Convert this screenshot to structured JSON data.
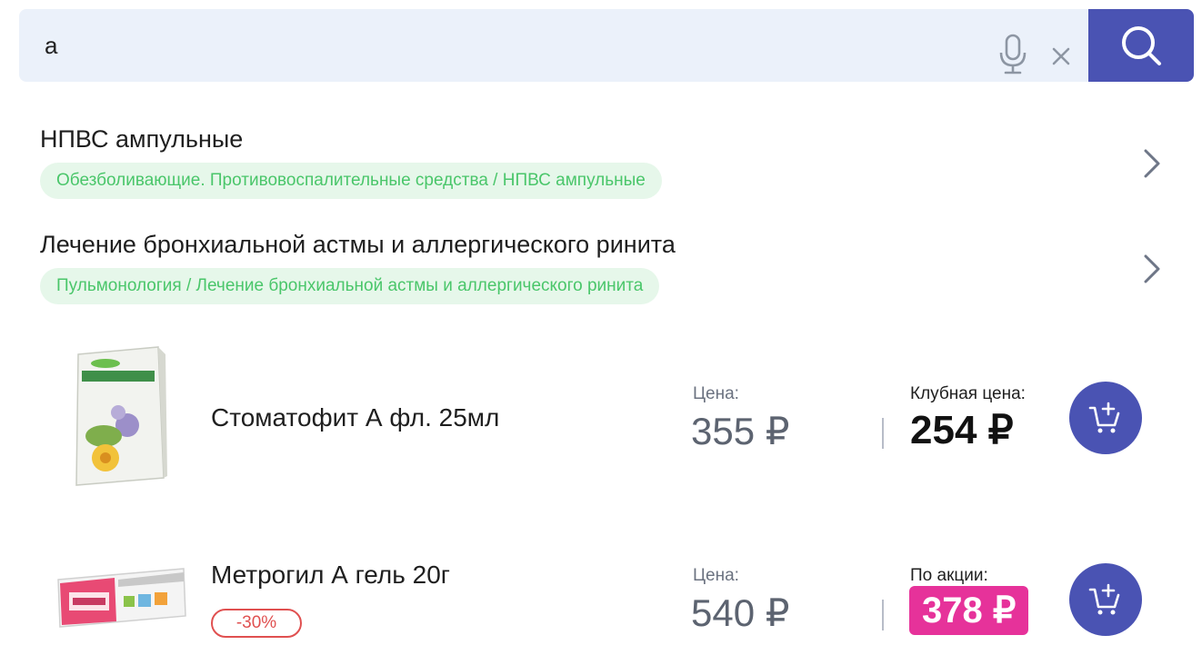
{
  "search": {
    "value": "а",
    "mic_icon": "microphone-icon",
    "clear_icon": "close-icon",
    "button_icon": "search-icon"
  },
  "categories": [
    {
      "title": "НПВС ампульные",
      "path": "Обезболивающие. Противовоспалительные средства / НПВС ампульные",
      "icon": "chevron-right-icon"
    },
    {
      "title": "Лечение бронхиальной астмы и аллергического ринита",
      "path": "Пульмонология / Лечение бронхиальной астмы и аллергического ринита",
      "icon": "chevron-right-icon"
    }
  ],
  "products": [
    {
      "name": "Стоматофит А фл. 25мл",
      "price_label": "Цена:",
      "price": "355 ₽",
      "club_label": "Клубная цена:",
      "club_price": "254 ₽",
      "cart_icon": "add-to-cart-icon"
    },
    {
      "name": "Метрогил А гель 20г",
      "discount": "-30%",
      "price_label": "Цена:",
      "price": "540 ₽",
      "promo_label": "По акции:",
      "promo_price": "378 ₽",
      "cart_icon": "add-to-cart-icon"
    }
  ],
  "colors": {
    "accent": "#4a53b3",
    "search_bg": "#ebf1fa",
    "tag_bg": "#e6f7ea",
    "tag_text": "#4ac66a",
    "promo": "#e6329a",
    "discount": "#e05050"
  }
}
